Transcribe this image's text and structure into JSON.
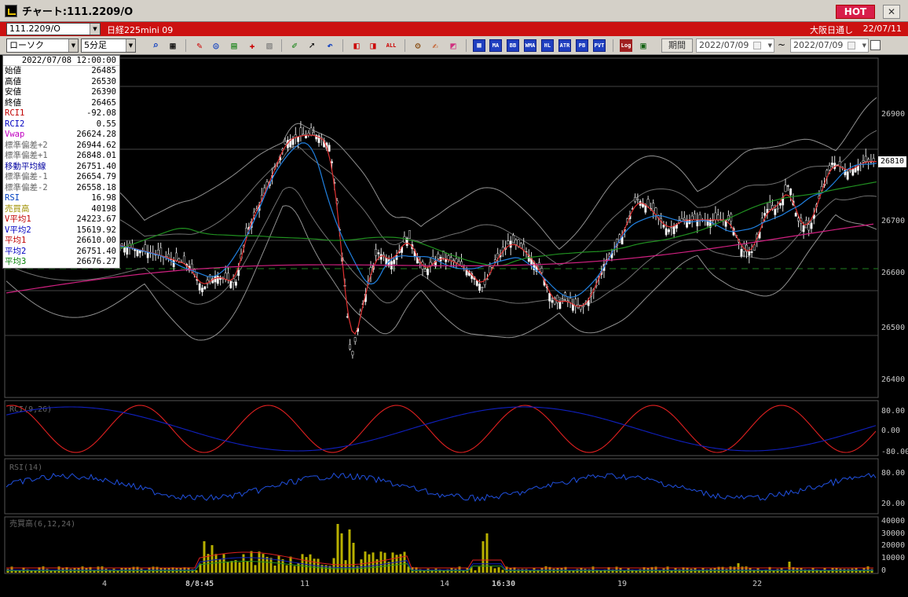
{
  "window": {
    "title": "チャート:111.2209/O",
    "hot_label": "HOT",
    "close_glyph": "✕"
  },
  "infobar": {
    "code": "111.2209/O",
    "instrument": "日経225mini 09",
    "session": "大阪日通し",
    "date": "22/07/11"
  },
  "toolbar": {
    "chart_type": "ローソク",
    "timeframe": "5分足",
    "period_label": "期間",
    "date_from": "2022/07/09",
    "date_to": "2022/07/09",
    "tilde": "~",
    "buttons": [
      "zoom",
      "grid",
      "draw",
      "trend",
      "fib",
      "text",
      "erase",
      "pen",
      "cursor",
      "undo",
      "left",
      "right",
      "all",
      "settings",
      "edit",
      "color",
      "tech",
      "MA",
      "BB",
      "WMA",
      "HL",
      "ATR",
      "PB",
      "PVT",
      "Log",
      "export"
    ],
    "btn_text": {
      "all": "ALL",
      "ma": "MA",
      "bb": "BB",
      "wma": "WMA",
      "hl": "HL",
      "atr": "ATR",
      "pb": "PB",
      "pvt": "PVT",
      "log": "Log"
    }
  },
  "data_panel": {
    "datetime": "2022/07/08 12:00:00",
    "rows": [
      {
        "label": "始値",
        "value": "26485",
        "color": "#000000"
      },
      {
        "label": "高値",
        "value": "26530",
        "color": "#000000"
      },
      {
        "label": "安値",
        "value": "26390",
        "color": "#000000"
      },
      {
        "label": "終値",
        "value": "26465",
        "color": "#000000"
      },
      {
        "label": "RCI1",
        "value": "-92.08",
        "color": "#c00000"
      },
      {
        "label": "RCI2",
        "value": "0.55",
        "color": "#0000c0"
      },
      {
        "label": "Vwap",
        "value": "26624.28",
        "color": "#c000c0"
      },
      {
        "label": "標準偏差+2",
        "value": "26944.62",
        "color": "#666666"
      },
      {
        "label": "標準偏差+1",
        "value": "26848.01",
        "color": "#666666"
      },
      {
        "label": "移動平均線",
        "value": "26751.40",
        "color": "#0000a0"
      },
      {
        "label": "標準偏差-1",
        "value": "26654.79",
        "color": "#666666"
      },
      {
        "label": "標準偏差-2",
        "value": "26558.18",
        "color": "#666666"
      },
      {
        "label": "RSI",
        "value": "16.98",
        "color": "#0040c0"
      },
      {
        "label": "売買高",
        "value": "40198",
        "color": "#a09000"
      },
      {
        "label": "V平均1",
        "value": "24223.67",
        "color": "#c00000"
      },
      {
        "label": "V平均2",
        "value": "15619.92",
        "color": "#0000c0"
      },
      {
        "label": "平均1",
        "value": "26610.00",
        "color": "#c00000"
      },
      {
        "label": "平均2",
        "value": "26751.40",
        "color": "#0000c0"
      },
      {
        "label": "平均3",
        "value": "26676.27",
        "color": "#008000"
      }
    ]
  },
  "price_axis": {
    "labels": [
      "26900",
      "26800",
      "26700",
      "26600",
      "26500",
      "26400"
    ],
    "current_price": "26810"
  },
  "panels": {
    "rci_label": "RCI(9,26)",
    "rci_levels": [
      "80.00",
      "0.00",
      "-80.00"
    ],
    "rsi_label": "RSI(14)",
    "rsi_levels": [
      "80.00",
      "20.00"
    ],
    "volume_label": "売買高(6,12,24)",
    "volume_levels": [
      "40000",
      "30000",
      "20000",
      "10000",
      "0"
    ]
  },
  "x_axis": {
    "labels": [
      "4",
      "8/8:45",
      "11",
      "14",
      "16:30",
      "19",
      "22"
    ]
  },
  "colors": {
    "bg": "#000000",
    "candle_up": "#ffffff",
    "candle_down": "#000000",
    "ma_red": "#e03030",
    "ma_blue": "#2080e0",
    "ma_green": "#209020",
    "vwap": "#d02080",
    "bands": "#909090",
    "volume": "#b8b000",
    "rci1": "#e02020",
    "rci2": "#1020c0",
    "rsi": "#2050e0"
  }
}
